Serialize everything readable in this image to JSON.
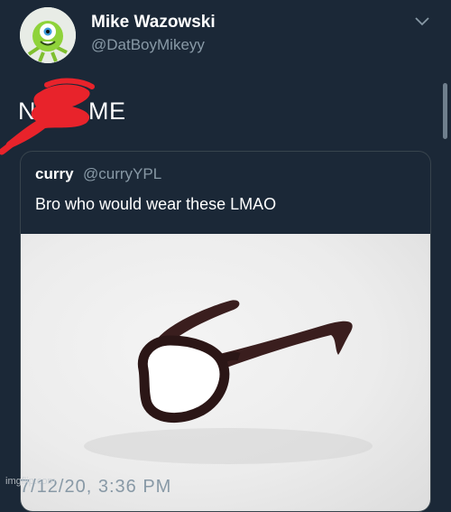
{
  "author": {
    "display_name": "Mike Wazowski",
    "handle": "@DatBoyMikeyy"
  },
  "tweet": {
    "visible_text_left": "N",
    "visible_text_right": "ME"
  },
  "quoted_tweet": {
    "display_name": "curry",
    "handle": "@curryYPL",
    "text": "Bro who would wear these LMAO"
  },
  "timestamp": "7/12/20, 3:36 PM",
  "watermark": "imgflip.com",
  "icons": {
    "menu": "chevron-down-icon",
    "avatar": "avatar-image"
  },
  "colors": {
    "background": "#1b2837",
    "secondary_text": "#8899a6",
    "border": "#38444d",
    "scribble": "#e8232b"
  }
}
